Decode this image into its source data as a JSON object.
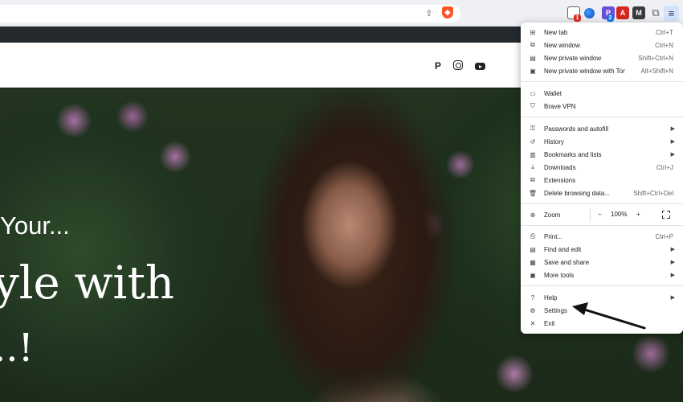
{
  "toolbar": {
    "share_icon": "share-icon",
    "brave_icon": "brave-shield-icon",
    "extensions": [
      {
        "name": "ext-notes-icon",
        "badge": "1"
      },
      {
        "name": "ext-globe-icon"
      },
      {
        "name": "ext-p-icon",
        "badge": "2"
      },
      {
        "name": "ext-pdf-icon"
      },
      {
        "name": "ext-m-icon"
      },
      {
        "name": "puzzle-icon"
      }
    ],
    "badge_1": "1",
    "badge_2": "2",
    "menu_icon": "hamburger-menu-icon"
  },
  "page": {
    "social": [
      "pinterest-icon",
      "instagram-icon",
      "youtube-icon"
    ],
    "hero": {
      "line1": "Your...",
      "line2": "yle with",
      "line3": "..!"
    }
  },
  "menu": {
    "new_tab": {
      "label": "New tab",
      "shortcut": "Ctrl+T"
    },
    "new_window": {
      "label": "New window",
      "shortcut": "Ctrl+N"
    },
    "new_private_window": {
      "label": "New private window",
      "shortcut": "Shift+Ctrl+N"
    },
    "new_private_tor": {
      "label": "New private window with Tor",
      "shortcut": "Alt+Shift+N"
    },
    "wallet": {
      "label": "Wallet"
    },
    "brave_vpn": {
      "label": "Brave VPN"
    },
    "passwords": {
      "label": "Passwords and autofill"
    },
    "history": {
      "label": "History"
    },
    "bookmarks": {
      "label": "Bookmarks and lists"
    },
    "downloads": {
      "label": "Downloads",
      "shortcut": "Ctrl+J"
    },
    "extensions": {
      "label": "Extensions"
    },
    "delete_browsing": {
      "label": "Delete browsing data...",
      "shortcut": "Shift+Ctrl+Del"
    },
    "zoom": {
      "label": "Zoom",
      "minus": "−",
      "value": "100%",
      "plus": "+"
    },
    "print": {
      "label": "Print...",
      "shortcut": "Ctrl+P"
    },
    "find_edit": {
      "label": "Find and edit"
    },
    "save_share": {
      "label": "Save and share"
    },
    "more_tools": {
      "label": "More tools"
    },
    "help": {
      "label": "Help"
    },
    "settings": {
      "label": "Settings"
    },
    "exit": {
      "label": "Exit"
    }
  }
}
